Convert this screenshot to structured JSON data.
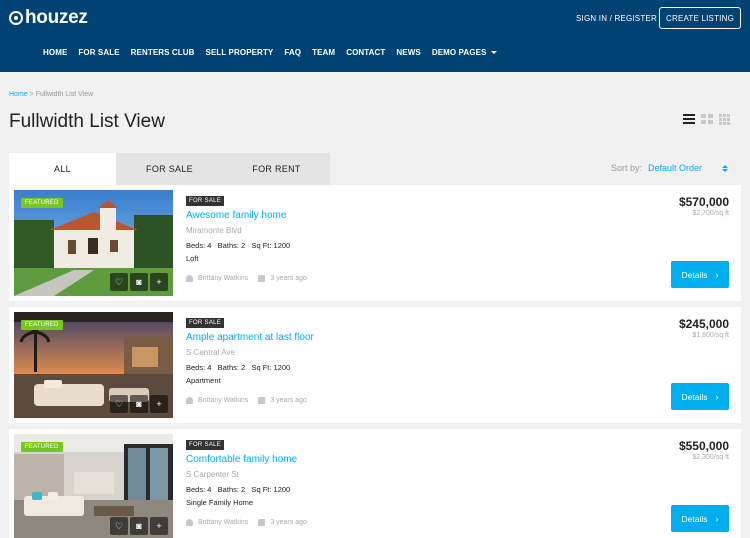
{
  "header": {
    "logo_text": "houzez",
    "signin_label": "SIGN IN / REGISTER",
    "create_listing_label": "CREATE LISTING",
    "nav": [
      {
        "label": "HOME"
      },
      {
        "label": "FOR SALE"
      },
      {
        "label": "RENTERS CLUB"
      },
      {
        "label": "SELL PROPERTY"
      },
      {
        "label": "FAQ"
      },
      {
        "label": "TEAM"
      },
      {
        "label": "CONTACT"
      },
      {
        "label": "NEWS"
      },
      {
        "label": "DEMO PAGES"
      }
    ]
  },
  "breadcrumb": {
    "home": "Home",
    "separator": ">",
    "current": "Fullwidth List View"
  },
  "page_title": "Fullwidth List View",
  "tabs": [
    {
      "label": "ALL",
      "active": true
    },
    {
      "label": "FOR SALE",
      "active": false
    },
    {
      "label": "FOR RENT",
      "active": false
    }
  ],
  "sort": {
    "label": "Sort by:",
    "value": "Default Order"
  },
  "listings": [
    {
      "featured_label": "FEATURED",
      "status_badge": "FOR SALE",
      "title": "Awesome family home",
      "address": "Miramonte Blvd",
      "specs": "Beds: 4   Baths: 2   Sq Ft: 1200",
      "type": "Loft",
      "agent": "Brittany Watkins",
      "posted": "3 years ago",
      "price": "$570,000",
      "price_per_sqft": "$2,700/sq ft",
      "details_label": "Details"
    },
    {
      "featured_label": "FEATURED",
      "status_badge": "FOR SALE",
      "title": "Ample apartment at last floor",
      "address": "S Central Ave",
      "specs": "Beds: 4   Baths: 2   Sq Ft: 1200",
      "type": "Apartment",
      "agent": "Brittany Watkins",
      "posted": "3 years ago",
      "price": "$245,000",
      "price_per_sqft": "$1,800/sq ft",
      "details_label": "Details"
    },
    {
      "featured_label": "FEATURED",
      "status_badge": "FOR SALE",
      "title": "Comfortable family home",
      "address": "S Carpenter St",
      "specs": "Beds: 4   Baths: 2   Sq Ft: 1200",
      "type": "Single Family Home",
      "agent": "Brittany Watkins",
      "posted": "3 years ago",
      "price": "$550,000",
      "price_per_sqft": "$2,300/sq ft",
      "details_label": "Details"
    }
  ],
  "colors": {
    "header_bg": "#004274",
    "accent": "#00aeef",
    "featured": "#77c720"
  },
  "icons": {
    "logo": "location-pin-icon",
    "view_list": "list-view-icon",
    "view_grid": "grid-view-icon",
    "view_grid_small": "grid-small-view-icon",
    "favorite": "heart-icon",
    "photos": "camera-icon",
    "add": "plus-icon",
    "agent": "user-icon",
    "date": "calendar-icon",
    "chevron": "chevron-right-icon"
  }
}
